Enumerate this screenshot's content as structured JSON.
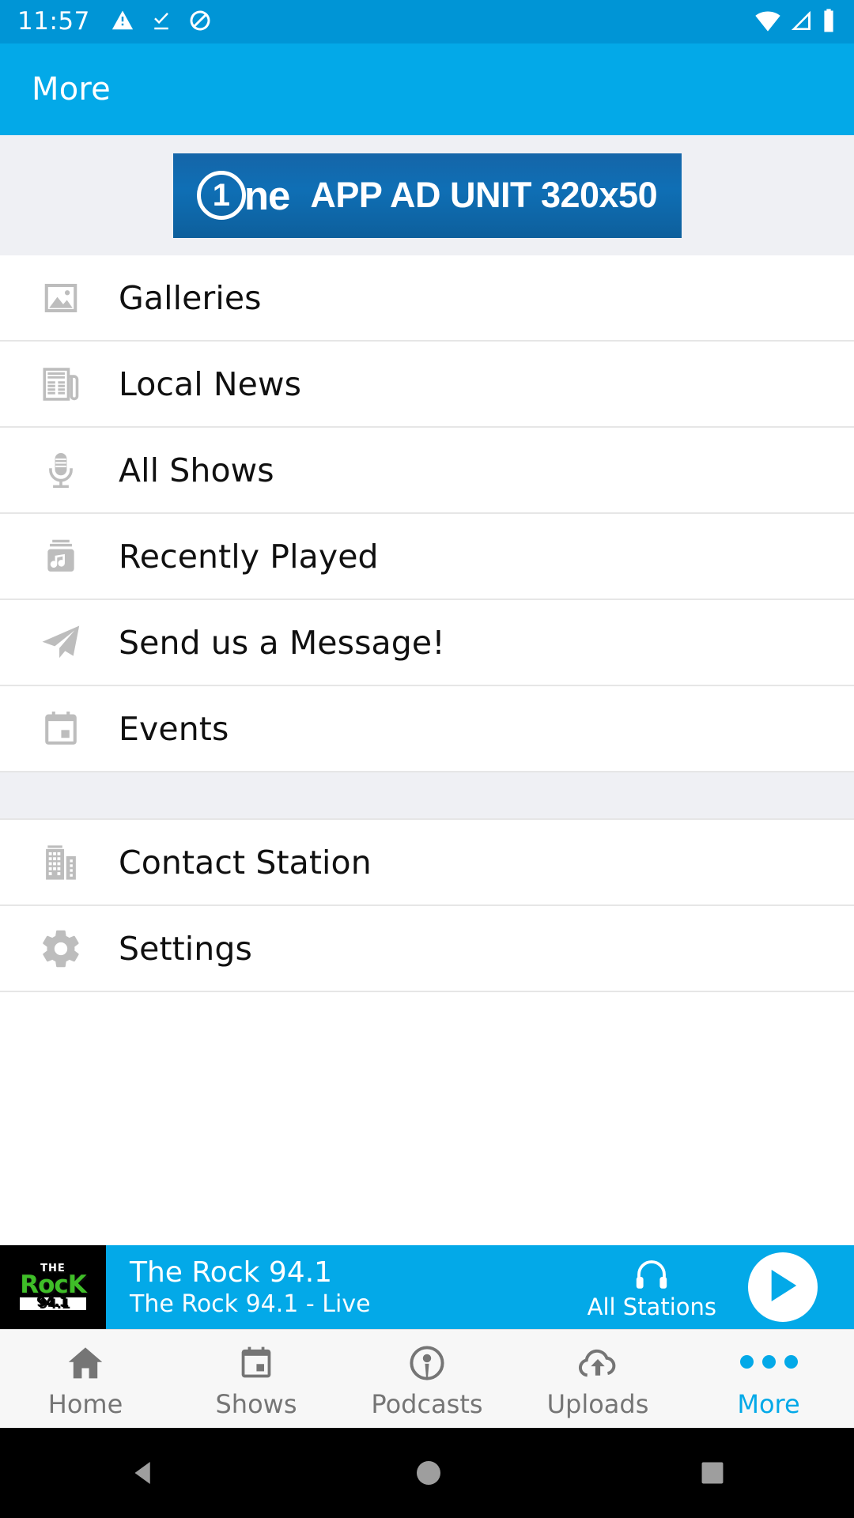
{
  "status_bar": {
    "time": "11:57",
    "left_icons": [
      "warning-icon",
      "download-done-icon",
      "do-not-disturb-icon"
    ],
    "right_icons": [
      "wifi-icon",
      "cellular-signal-icon",
      "battery-icon"
    ],
    "background": "#0095d6"
  },
  "app_bar": {
    "title": "More",
    "background": "#03a9e8",
    "text_color": "#ffffff"
  },
  "ad": {
    "logo_digit": "1",
    "logo_suffix": "ne",
    "text": "APP AD UNIT 320x50",
    "background_start": "#1565a8",
    "background_end": "#0d5f9c",
    "region_background": "#eff0f4"
  },
  "menu": {
    "group_one": [
      {
        "label": "Galleries",
        "icon": "image-icon"
      },
      {
        "label": "Local News",
        "icon": "newspaper-icon"
      },
      {
        "label": "All Shows",
        "icon": "microphone-icon"
      },
      {
        "label": "Recently Played",
        "icon": "music-album-icon"
      },
      {
        "label": "Send us a Message!",
        "icon": "paper-plane-icon"
      },
      {
        "label": "Events",
        "icon": "calendar-icon"
      }
    ],
    "group_two": [
      {
        "label": "Contact Station",
        "icon": "building-icon"
      },
      {
        "label": "Settings",
        "icon": "gear-icon"
      }
    ],
    "icon_color": "#bdbdbd",
    "label_color": "#101010"
  },
  "now_playing": {
    "artwork_the": "THE",
    "artwork_rock": "RocK",
    "artwork_freq": "94.1",
    "title": "The Rock 94.1",
    "subtitle": "The Rock 94.1  - Live",
    "all_stations_label": "All Stations",
    "all_stations_icon": "headphones-icon",
    "play_icon": "play-icon",
    "background": "#03a9e8"
  },
  "bottom_nav": {
    "items": [
      {
        "label": "Home",
        "icon": "home-icon",
        "active": false
      },
      {
        "label": "Shows",
        "icon": "calendar-icon",
        "active": false
      },
      {
        "label": "Podcasts",
        "icon": "podcast-icon",
        "active": false
      },
      {
        "label": "Uploads",
        "icon": "cloud-upload-icon",
        "active": false
      },
      {
        "label": "More",
        "icon": "more-dots-icon",
        "active": true
      }
    ],
    "active_color": "#03a9e8",
    "inactive_color": "#757575",
    "background": "#f7f7f7"
  },
  "system_nav": {
    "buttons": [
      "back-icon",
      "home-icon",
      "recents-icon"
    ],
    "background": "#000000",
    "icon_color": "#9e9e9e"
  }
}
